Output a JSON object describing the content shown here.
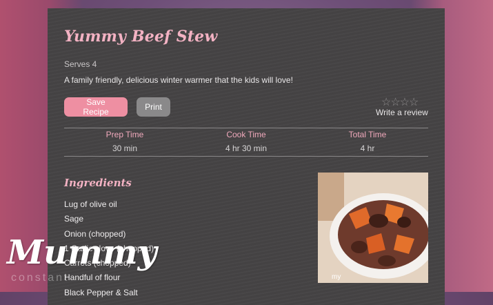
{
  "recipe": {
    "title": "Yummy Beef Stew",
    "serves": "Serves 4",
    "description": "A family friendly, delicious winter warmer that the kids will love!",
    "save_label": "Save Recipe",
    "print_label": "Print",
    "rating_stars": "☆☆☆☆",
    "review_label": "Write a review",
    "times": [
      {
        "label": "Prep Time",
        "value": "30 min"
      },
      {
        "label": "Cook Time",
        "value": "4 hr 30 min"
      },
      {
        "label": "Total Time",
        "value": "4 hr"
      }
    ],
    "ingredients_heading": "Ingredients",
    "ingredients": [
      "Lug of olive oil",
      "Sage",
      "Onion (chopped)",
      "1 Garlic clove (chopped)",
      "Carrots (chopped)",
      "Handful of flour",
      "Black Pepper & Salt"
    ],
    "photo_caption": "my"
  },
  "watermark": {
    "script": "Mummy",
    "sub": "constant"
  },
  "colors": {
    "accent": "#f3b2c3",
    "card": "#454344",
    "save_button": "#ee8fa2",
    "print_button": "#8a898a"
  }
}
